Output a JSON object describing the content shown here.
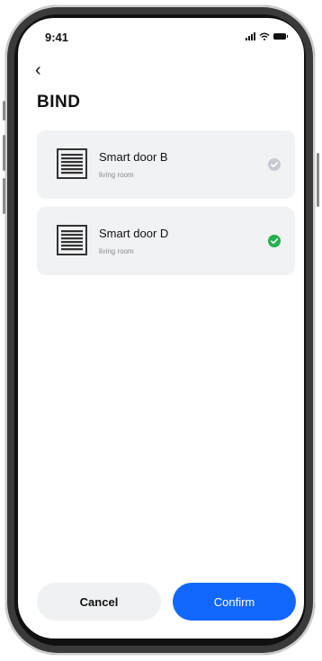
{
  "status_bar": {
    "time": "9:41"
  },
  "header": {
    "back_glyph": "‹",
    "title": "BIND"
  },
  "devices": [
    {
      "name": "Smart door B",
      "room": "living room",
      "icon": "door-icon",
      "selected": false
    },
    {
      "name": "Smart door D",
      "room": "living room",
      "icon": "door-icon",
      "selected": true
    }
  ],
  "actions": {
    "cancel_label": "Cancel",
    "confirm_label": "Confirm"
  },
  "colors": {
    "primary": "#1267ff",
    "check_selected": "#22b14c",
    "check_unselected": "#c6c9cf",
    "card_bg": "#f1f2f4"
  }
}
